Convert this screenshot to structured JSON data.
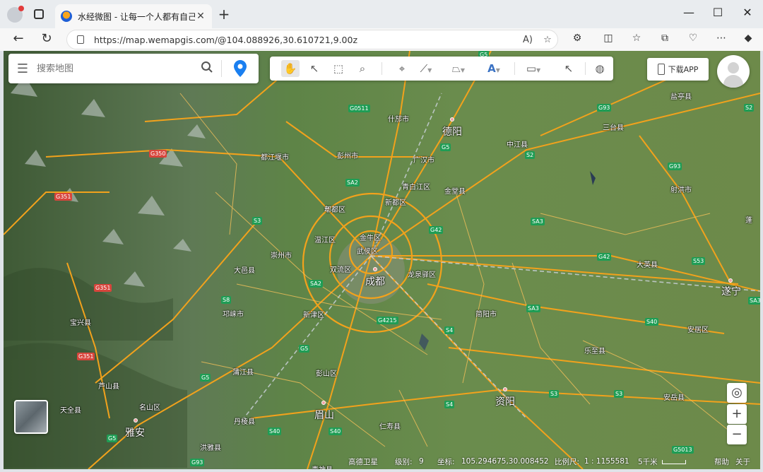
{
  "browser": {
    "tab_title": "水经微图 - 让每一个人都有自己的",
    "url": "https://map.wemapgis.com/@104.088926,30.610721,9.00z"
  },
  "search": {
    "placeholder": "搜索地图"
  },
  "toolbar_icons": [
    "hand-icon",
    "select-icon",
    "box-select-icon",
    "zoom-rect-icon",
    "marker-icon",
    "polyline-icon",
    "polygon-icon",
    "text-icon",
    "measure-icon",
    "query-icon",
    "globe-icon"
  ],
  "download_app": "下载APP",
  "places": [
    {
      "id": "shifang",
      "name": "什邡市"
    },
    {
      "id": "deyang",
      "name": "德阳"
    },
    {
      "id": "zhongjiang",
      "name": "中江县"
    },
    {
      "id": "santai",
      "name": "三台县"
    },
    {
      "id": "yanting",
      "name": "盐亭县"
    },
    {
      "id": "shehong",
      "name": "射洪市"
    },
    {
      "id": "dujiangyan",
      "name": "都江堰市"
    },
    {
      "id": "pengzhou",
      "name": "彭州市"
    },
    {
      "id": "guanghan",
      "name": "广汉市"
    },
    {
      "id": "qingbaijiang",
      "name": "青白江区"
    },
    {
      "id": "jintang",
      "name": "金堂县"
    },
    {
      "id": "xindu",
      "name": "新都区"
    },
    {
      "id": "pixian",
      "name": "郫都区"
    },
    {
      "id": "wenjiang",
      "name": "温江区"
    },
    {
      "id": "jinniu",
      "name": "金牛区"
    },
    {
      "id": "wuhou",
      "name": "武侯区"
    },
    {
      "id": "chongzhou",
      "name": "崇州市"
    },
    {
      "id": "dayi",
      "name": "大邑县"
    },
    {
      "id": "shuangliu",
      "name": "双流区"
    },
    {
      "id": "chengdu",
      "name": "成都"
    },
    {
      "id": "longquanyi",
      "name": "龙泉驿区"
    },
    {
      "id": "qionglai",
      "name": "邛崃市"
    },
    {
      "id": "xinjin",
      "name": "新津区"
    },
    {
      "id": "jianyang",
      "name": "简阳市"
    },
    {
      "id": "daying",
      "name": "大英县"
    },
    {
      "id": "suining",
      "name": "遂宁"
    },
    {
      "id": "baoxing",
      "name": "宝兴县"
    },
    {
      "id": "pujiang",
      "name": "蒲江县"
    },
    {
      "id": "pengshan",
      "name": "彭山区"
    },
    {
      "id": "anju",
      "name": "安居区"
    },
    {
      "id": "lezhi",
      "name": "乐至县"
    },
    {
      "id": "lushan",
      "name": "芦山县"
    },
    {
      "id": "tianquan",
      "name": "天全县"
    },
    {
      "id": "mingshan",
      "name": "名山区"
    },
    {
      "id": "meishan",
      "name": "眉山"
    },
    {
      "id": "ziyang",
      "name": "资阳"
    },
    {
      "id": "anyue",
      "name": "安岳县"
    },
    {
      "id": "yaan",
      "name": "雅安"
    },
    {
      "id": "danleng",
      "name": "丹棱县"
    },
    {
      "id": "renshou",
      "name": "仁寿县"
    },
    {
      "id": "hongya",
      "name": "洪雅县"
    },
    {
      "id": "qingshen",
      "name": "青神县"
    },
    {
      "id": "peng",
      "name": "蓬"
    }
  ],
  "road_shields": [
    "G5",
    "G93",
    "S2",
    "G0511",
    "G5",
    "S2",
    "G350",
    "G351",
    "G93",
    "SA2",
    "S3",
    "SA3",
    "G42",
    "SA3",
    "G42",
    "S53",
    "S8",
    "SA2",
    "SA3",
    "G4215",
    "S4",
    "S40",
    "G5",
    "S3",
    "S3",
    "G351",
    "G5",
    "S4",
    "S40",
    "G351",
    "S40",
    "G5",
    "G93",
    "G5013"
  ],
  "status": {
    "source": "高德卫星",
    "level_label": "级别:",
    "level": "9",
    "coord_label": "坐标:",
    "coord": "105.294675,30.008452",
    "scale_label": "比例尺:",
    "scale": "1 : 1155581",
    "scale_dist": "5千米",
    "help": "帮助",
    "about": "关于"
  }
}
